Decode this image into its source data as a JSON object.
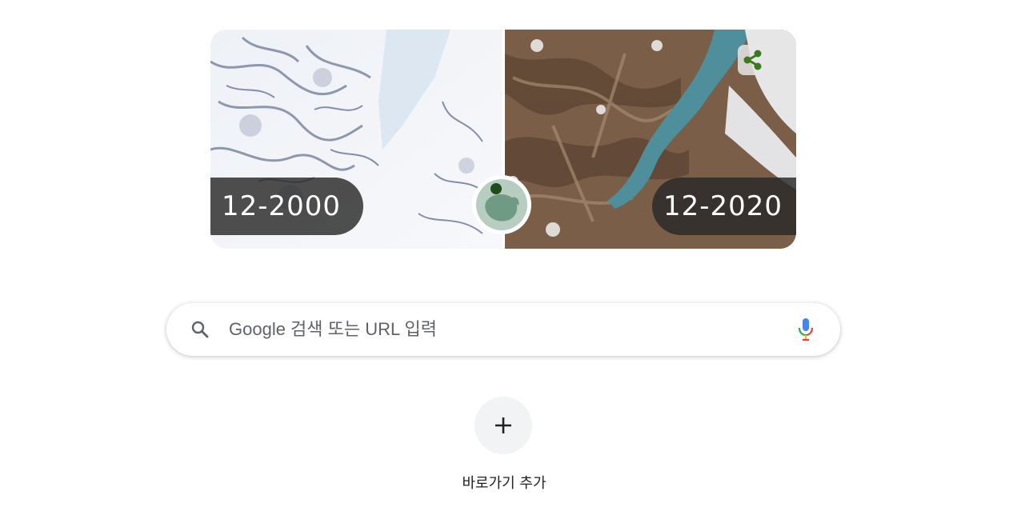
{
  "doodle": {
    "before_label": "12-2000",
    "after_label": "12-2020",
    "share_icon": "share-icon",
    "slider_icon": "globe-location-icon"
  },
  "search": {
    "placeholder": "Google 검색 또는 URL 입력",
    "value": "",
    "search_icon": "search-icon",
    "mic_icon": "mic-icon"
  },
  "shortcut": {
    "add_icon": "plus-icon",
    "label": "바로가기 추가"
  },
  "colors": {
    "share_green": "#3c7a1e",
    "label_bg": "#2a2a2a",
    "mic_blue": "#4285f4",
    "mic_red": "#ea4335",
    "mic_yellow": "#fbbc04",
    "mic_green": "#34a853",
    "shortcut_bg": "#f1f3f4"
  }
}
